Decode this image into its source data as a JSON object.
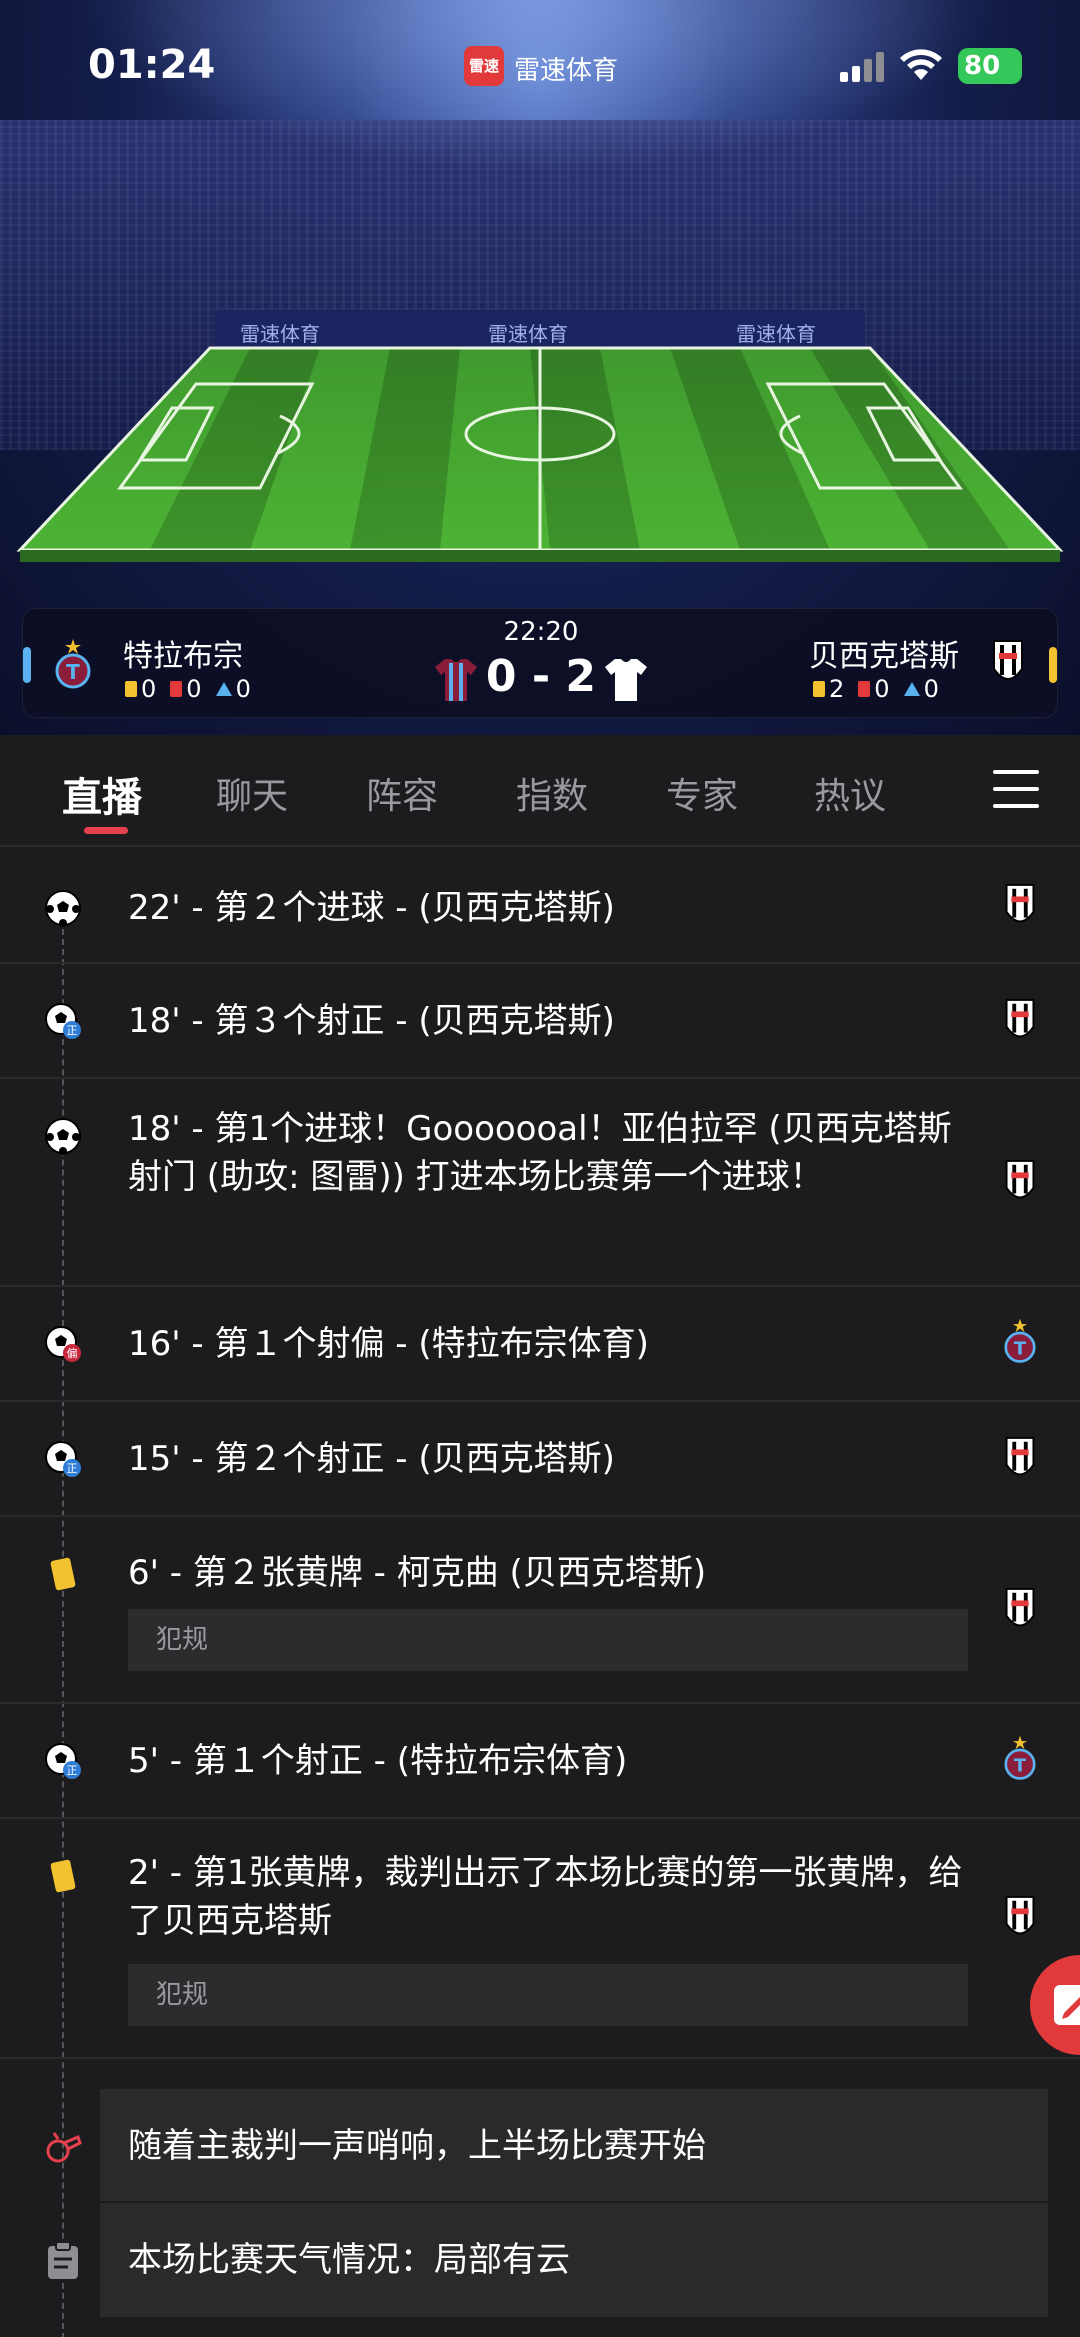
{
  "status_bar": {
    "time": "01:24",
    "app_badge": "雷速",
    "app_name": "雷速体育",
    "battery": "80"
  },
  "stadium": {
    "ad_text": "雷速体育"
  },
  "match": {
    "time": "22:20",
    "home": {
      "name": "特拉布宗",
      "yellow": "0",
      "red": "0",
      "corner": "0"
    },
    "away": {
      "name": "贝西克塔斯",
      "yellow": "2",
      "red": "0",
      "corner": "0"
    },
    "score": "0 - 2",
    "colors": {
      "yellow": "#f2c230",
      "red": "#e23a3a",
      "home_accent": "#5ab3f0",
      "away_accent": "#f2c230"
    }
  },
  "tabs": [
    {
      "label": "直播",
      "active": true
    },
    {
      "label": "聊天"
    },
    {
      "label": "阵容"
    },
    {
      "label": "指数"
    },
    {
      "label": "专家"
    },
    {
      "label": "热议"
    }
  ],
  "events": [
    {
      "icon": "soccer-ball-icon",
      "text": "22' - 第２个进球 - (贝西克塔斯)",
      "team": "away"
    },
    {
      "icon": "shot-on-target-icon",
      "text": "18' - 第３个射正 - (贝西克塔斯)",
      "team": "away"
    },
    {
      "icon": "soccer-ball-icon",
      "text": "18' - 第1个进球！Gooooooal！亚伯拉罕 (贝西克塔斯 射门 (助攻: 图雷)) 打进本场比赛第一个进球！",
      "team": "away"
    },
    {
      "icon": "shot-off-target-icon",
      "text": "16' - 第１个射偏 - (特拉布宗体育)",
      "team": "home"
    },
    {
      "icon": "shot-on-target-icon",
      "text": "15' - 第２个射正 - (贝西克塔斯)",
      "team": "away"
    },
    {
      "icon": "yellow-card-icon",
      "text": "6' - 第２张黄牌 - 柯克曲 (贝西克塔斯)",
      "note": "犯规",
      "team": "away"
    },
    {
      "icon": "shot-on-target-icon",
      "text": "5' - 第１个射正 - (特拉布宗体育)",
      "team": "home"
    },
    {
      "icon": "yellow-card-icon",
      "text": "2' - 第1张黄牌，裁判出示了本场比赛的第一张黄牌，给了贝西克塔斯",
      "note": "犯规",
      "team": "away"
    },
    {
      "icon": "whistle-icon",
      "text": "随着主裁判一声哨响，上半场比赛开始"
    },
    {
      "icon": "clipboard-icon",
      "text": "本场比赛天气情况：局部有云"
    }
  ]
}
